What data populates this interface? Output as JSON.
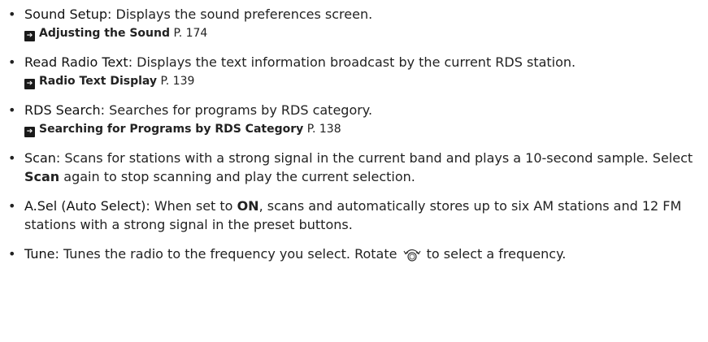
{
  "items": [
    {
      "term": "Sound Setup",
      "desc": ": Displays the sound preferences screen.",
      "xref_title": "Adjusting the Sound",
      "xref_page": " P. 174"
    },
    {
      "term": "Read Radio Text",
      "desc": ": Displays the text information broadcast by the current RDS station.",
      "xref_title": "Radio Text Display",
      "xref_page": " P. 139"
    },
    {
      "term": "RDS Search",
      "desc": ": Searches for programs by RDS category.",
      "xref_title": "Searching for Programs by RDS Category",
      "xref_page": " P. 138"
    },
    {
      "term": "Scan",
      "desc_a": ": Scans for stations with a strong signal in the current band and plays a 10-second sample. Select ",
      "kw": "Scan",
      "desc_b": " again to stop scanning and play the current selection."
    },
    {
      "term": "A.Sel (Auto Select)",
      "desc_a": ": When set to ",
      "kw": "ON",
      "desc_b": ", scans and automatically stores up to six AM stations and 12 FM stations with a strong signal in the preset buttons."
    },
    {
      "term": "Tune",
      "desc_a": ": Tunes the radio to the frequency you select. Rotate ",
      "icon": "selector-knob-icon",
      "desc_b": " to select a frequency."
    }
  ]
}
